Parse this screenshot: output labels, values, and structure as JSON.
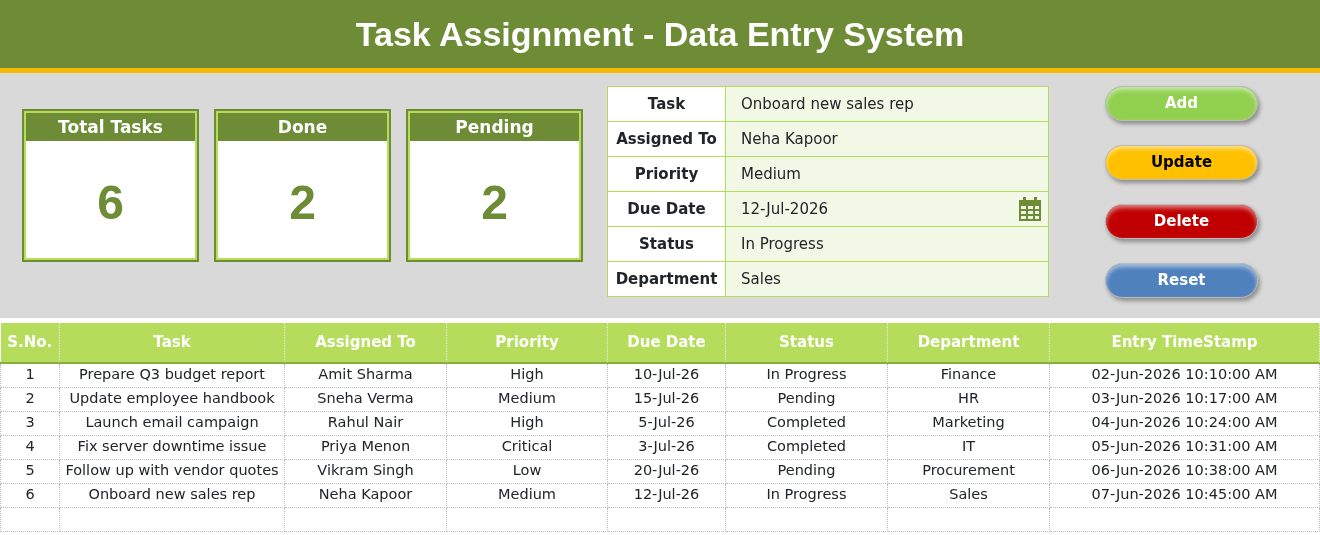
{
  "title": "Task Assignment - Data Entry System",
  "stats": [
    {
      "label": "Total Tasks",
      "value": "6"
    },
    {
      "label": "Done",
      "value": "2"
    },
    {
      "label": "Pending",
      "value": "2"
    }
  ],
  "form": [
    {
      "label": "Task",
      "value": "Onboard new sales rep"
    },
    {
      "label": "Assigned To",
      "value": "Neha Kapoor"
    },
    {
      "label": "Priority",
      "value": "Medium"
    },
    {
      "label": "Due Date",
      "value": "12-Jul-2026",
      "kind": "date"
    },
    {
      "label": "Status",
      "value": "In Progress"
    },
    {
      "label": "Department",
      "value": "Sales"
    }
  ],
  "buttons": [
    {
      "label": "Add",
      "color": "#92d050"
    },
    {
      "label": "Update",
      "color": "#ffc000"
    },
    {
      "label": "Delete",
      "color": "#c00000"
    },
    {
      "label": "Reset",
      "color": "#4f81bd"
    }
  ],
  "table": {
    "columns": [
      "S.No.",
      "Task",
      "Assigned To",
      "Priority",
      "Due Date",
      "Status",
      "Department",
      "Entry TimeStamp"
    ],
    "rows": [
      [
        "1",
        "Prepare Q3 budget report",
        "Amit Sharma",
        "High",
        "10-Jul-26",
        "In Progress",
        "Finance",
        "02-Jun-2026 10:10:00 AM"
      ],
      [
        "2",
        "Update employee handbook",
        "Sneha Verma",
        "Medium",
        "15-Jul-26",
        "Pending",
        "HR",
        "03-Jun-2026 10:17:00 AM"
      ],
      [
        "3",
        "Launch email campaign",
        "Rahul Nair",
        "High",
        "5-Jul-26",
        "Completed",
        "Marketing",
        "04-Jun-2026 10:24:00 AM"
      ],
      [
        "4",
        "Fix server downtime issue",
        "Priya Menon",
        "Critical",
        "3-Jul-26",
        "Completed",
        "IT",
        "05-Jun-2026 10:31:00 AM"
      ],
      [
        "5",
        "Follow up with vendor quotes",
        "Vikram Singh",
        "Low",
        "20-Jul-26",
        "Pending",
        "Procurement",
        "06-Jun-2026 10:38:00 AM"
      ],
      [
        "6",
        "Onboard new sales rep",
        "Neha Kapoor",
        "Medium",
        "12-Jul-26",
        "In Progress",
        "Sales",
        "07-Jun-2026 10:45:00 AM"
      ]
    ]
  }
}
